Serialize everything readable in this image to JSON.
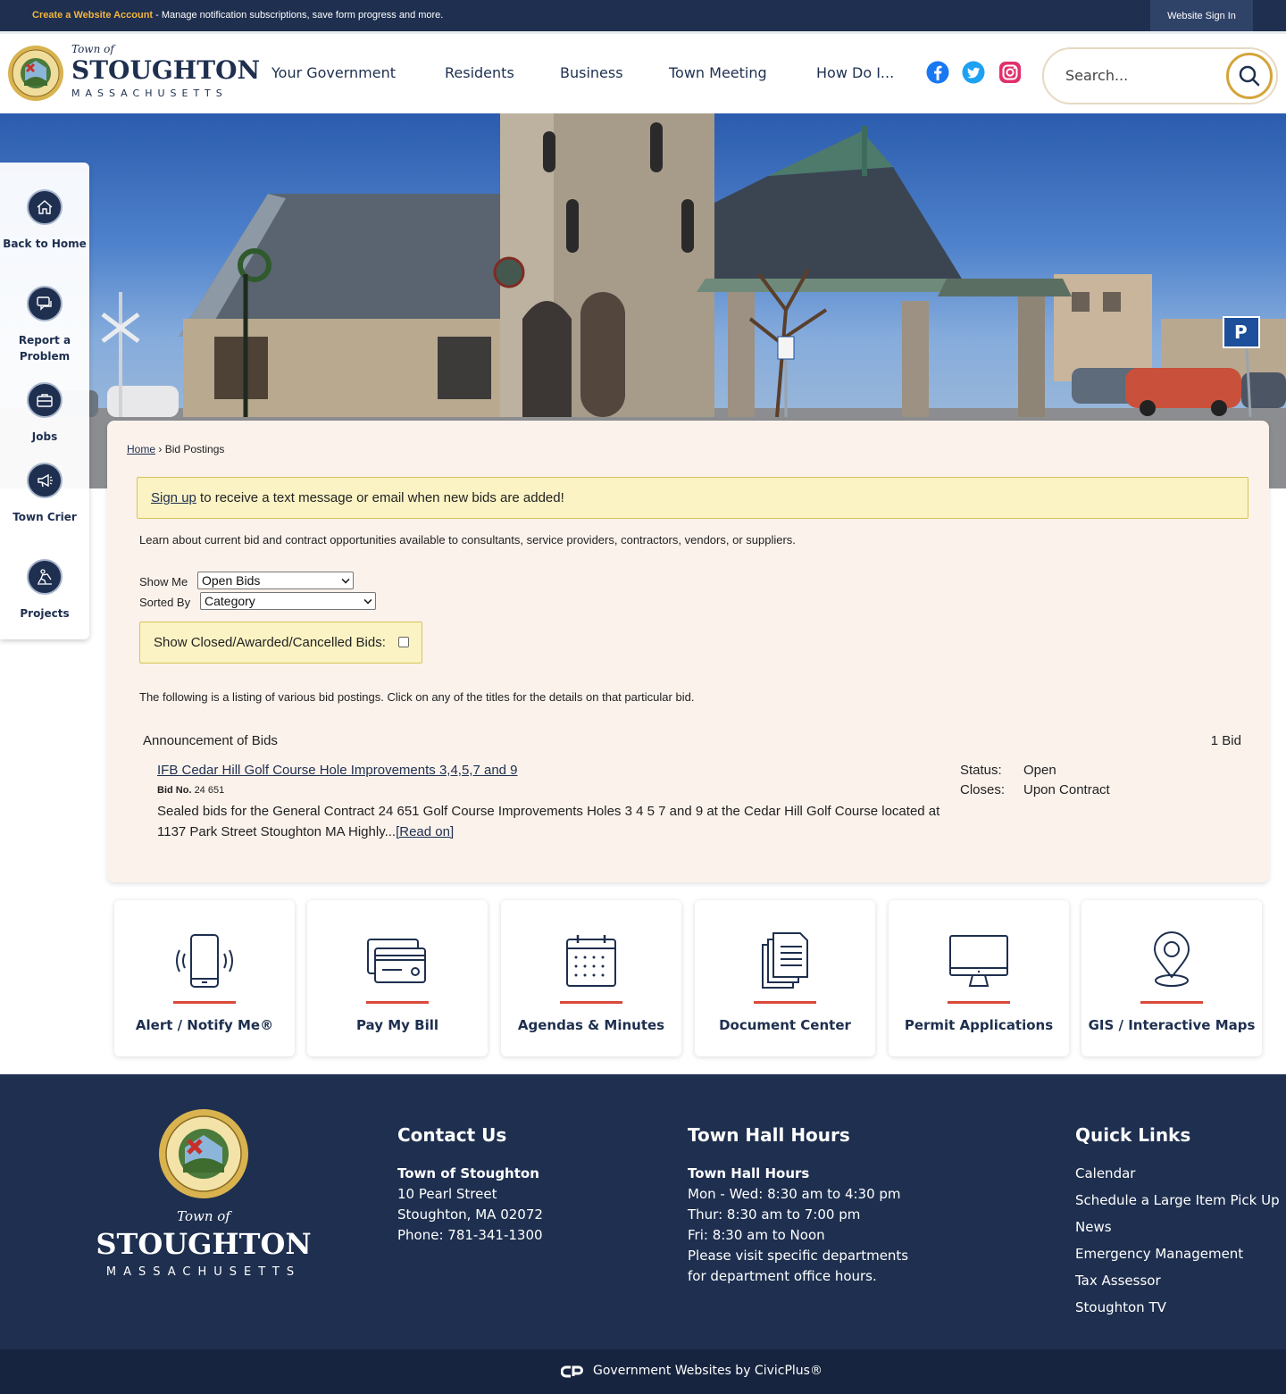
{
  "topbar": {
    "create_account": "Create a Website Account",
    "notice": " - Manage notification subscriptions, save form progress and more.",
    "signin": "Website Sign In"
  },
  "logo": {
    "town_of": "Town of",
    "name": "STOUGHTON",
    "state": "MASSACHUSETTS"
  },
  "nav": {
    "items": [
      "Your Government",
      "Residents",
      "Business",
      "Town Meeting",
      "How Do I..."
    ]
  },
  "social": {
    "icons": [
      "facebook-icon",
      "twitter-icon",
      "instagram-icon"
    ],
    "colors": [
      "#1877f2",
      "#1da1f2",
      "#e1306c"
    ]
  },
  "search": {
    "placeholder": "Search..."
  },
  "sidenav": {
    "items": [
      {
        "label": "Back to Home",
        "icon": "home-icon"
      },
      {
        "label": "Report a Problem",
        "icon": "chat-icon"
      },
      {
        "label": "Jobs",
        "icon": "briefcase-icon"
      },
      {
        "label": "Town Crier",
        "icon": "megaphone-icon"
      },
      {
        "label": "Projects",
        "icon": "worker-icon"
      }
    ]
  },
  "breadcrumb": {
    "home": "Home",
    "separator": " › ",
    "current": "Bid Postings"
  },
  "signup": {
    "link": "Sign up",
    "text": " to receive a text message or email when new bids are added!"
  },
  "intro": "Learn about current bid and contract opportunities available to consultants, service providers, contractors, vendors, or suppliers.",
  "filters": {
    "show_me_label": "Show Me",
    "show_me_value": "Open Bids",
    "sorted_by_label": "Sorted By",
    "sorted_by_value": "Category",
    "show_closed_label": "Show Closed/Awarded/Cancelled Bids:",
    "show_closed_checked": false
  },
  "listing_text": "The following is a listing of various bid postings. Click on any of the titles for the details on that particular bid.",
  "category": {
    "title": "Announcement of Bids",
    "count": "1 Bid"
  },
  "bid": {
    "title": "IFB Cedar Hill Golf Course Hole Improvements 3,4,5,7 and 9",
    "number_label": "Bid No.",
    "number": "24 651",
    "description": "Sealed bids for the General Contract 24 651 Golf Course Improvements Holes 3 4 5 7 and 9 at the Cedar Hill Golf Course located at 1137 Park Street Stoughton MA Highly...",
    "read_on": "[Read on]",
    "status_label": "Status:",
    "status": "Open",
    "closes_label": "Closes:",
    "closes": "Upon Contract"
  },
  "tiles": [
    {
      "label": "Alert / Notify Me®",
      "icon": "phone-alert-icon"
    },
    {
      "label": "Pay My Bill",
      "icon": "credit-card-icon"
    },
    {
      "label": "Agendas & Minutes",
      "icon": "calendar-icon"
    },
    {
      "label": "Document Center",
      "icon": "documents-icon"
    },
    {
      "label": "Permit Applications",
      "icon": "monitor-icon"
    },
    {
      "label": "GIS / Interactive Maps",
      "icon": "map-pin-icon"
    }
  ],
  "footer": {
    "contact": {
      "heading": "Contact Us",
      "org": "Town of Stoughton",
      "address1": "10 Pearl Street",
      "address2": "Stoughton, MA 02072",
      "phone": "Phone: 781-341-1300"
    },
    "hours": {
      "heading": "Town Hall Hours",
      "subheading": "Town Hall Hours",
      "line1": "Mon - Wed: 8:30 am to 4:30 pm",
      "line2": "Thur: 8:30 am to 7:00 pm",
      "line3": "Fri: 8:30 am to Noon",
      "line4": "Please visit specific departments for department office hours."
    },
    "quick_links": {
      "heading": "Quick Links",
      "items": [
        "Calendar",
        "Schedule a Large Item Pick Up",
        "News",
        "Emergency Management",
        "Tax Assessor",
        "Stoughton TV"
      ]
    },
    "civicplus": "Government Websites by CivicPlus®"
  },
  "colors": {
    "navy": "#1e2f4f",
    "gold": "#d4a43a",
    "accent_red": "#d94a3a",
    "card_bg": "#fbf2ec",
    "notice_yellow": "#fbf3c4"
  }
}
